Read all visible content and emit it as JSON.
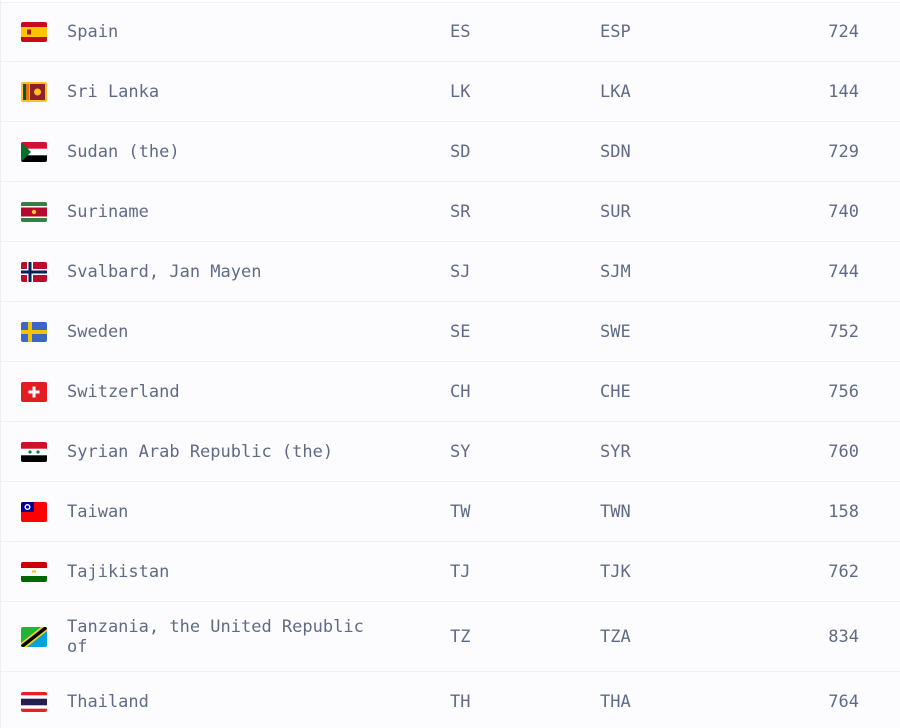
{
  "rows": [
    {
      "flag_icon": "spain-flag-icon",
      "name": "Spain",
      "alpha2": "ES",
      "alpha3": "ESP",
      "numeric": "724"
    },
    {
      "flag_icon": "sri-lanka-flag-icon",
      "name": "Sri Lanka",
      "alpha2": "LK",
      "alpha3": "LKA",
      "numeric": "144"
    },
    {
      "flag_icon": "sudan-flag-icon",
      "name": "Sudan (the)",
      "alpha2": "SD",
      "alpha3": "SDN",
      "numeric": "729"
    },
    {
      "flag_icon": "suriname-flag-icon",
      "name": "Suriname",
      "alpha2": "SR",
      "alpha3": "SUR",
      "numeric": "740"
    },
    {
      "flag_icon": "svalbard-flag-icon",
      "name": "Svalbard, Jan Mayen",
      "alpha2": "SJ",
      "alpha3": "SJM",
      "numeric": "744"
    },
    {
      "flag_icon": "sweden-flag-icon",
      "name": "Sweden",
      "alpha2": "SE",
      "alpha3": "SWE",
      "numeric": "752"
    },
    {
      "flag_icon": "switzerland-flag-icon",
      "name": "Switzerland",
      "alpha2": "CH",
      "alpha3": "CHE",
      "numeric": "756"
    },
    {
      "flag_icon": "syria-flag-icon",
      "name": "Syrian Arab Republic (the)",
      "alpha2": "SY",
      "alpha3": "SYR",
      "numeric": "760"
    },
    {
      "flag_icon": "taiwan-flag-icon",
      "name": "Taiwan",
      "alpha2": "TW",
      "alpha3": "TWN",
      "numeric": "158"
    },
    {
      "flag_icon": "tajikistan-flag-icon",
      "name": "Tajikistan",
      "alpha2": "TJ",
      "alpha3": "TJK",
      "numeric": "762"
    },
    {
      "flag_icon": "tanzania-flag-icon",
      "name": "Tanzania, the United Republic of",
      "alpha2": "TZ",
      "alpha3": "TZA",
      "numeric": "834"
    },
    {
      "flag_icon": "thailand-flag-icon",
      "name": "Thailand",
      "alpha2": "TH",
      "alpha3": "THA",
      "numeric": "764"
    }
  ],
  "colors": {
    "text": "#5f6b85",
    "row_background": "#fcfcfe",
    "row_border": "#eef0f7"
  }
}
